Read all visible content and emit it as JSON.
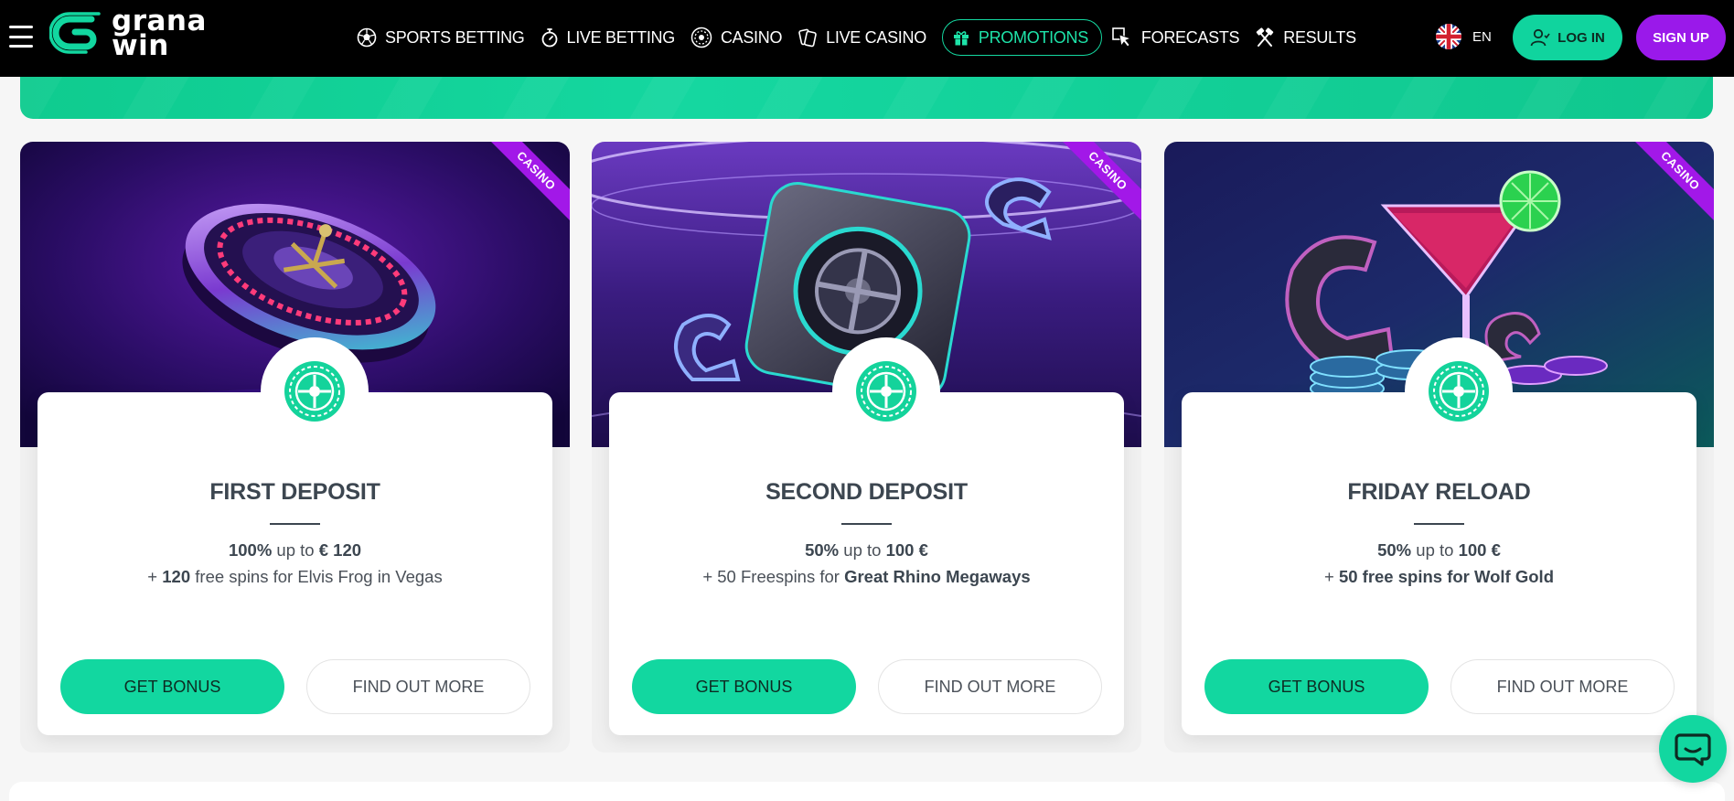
{
  "brand": {
    "logo_line1": "grana",
    "logo_line2": "win"
  },
  "nav": {
    "items": [
      {
        "label": "SPORTS BETTING",
        "icon": "soccer-ball-icon"
      },
      {
        "label": "LIVE BETTING",
        "icon": "stopwatch-icon"
      },
      {
        "label": "CASINO",
        "icon": "roulette-icon"
      },
      {
        "label": "LIVE CASINO",
        "icon": "cards-icon"
      },
      {
        "label": "PROMOTIONS",
        "icon": "gift-icon",
        "active": true
      },
      {
        "label": "FORECASTS",
        "icon": "cursor-click-icon"
      },
      {
        "label": "RESULTS",
        "icon": "crossed-hammers-icon"
      }
    ]
  },
  "header": {
    "language": "EN",
    "login_label": "LOG IN",
    "signup_label": "SIGN UP"
  },
  "colors": {
    "accent": "#12d7a0",
    "brand_purple": "#9a19ea",
    "header_bg": "#000000"
  },
  "promos": [
    {
      "badge": "CASINO",
      "title": "FIRST DEPOSIT",
      "line1_bold1": "100%",
      "line1_text": " up to ",
      "line1_bold2": "€ 120",
      "line2_text1": "+ ",
      "line2_bold": "120",
      "line2_text2": " free spins for Elvis Frog in Vegas",
      "get_bonus_label": "GET BONUS",
      "find_out_label": "FIND OUT MORE"
    },
    {
      "badge": "CASINO",
      "title": "SECOND DEPOSIT",
      "line1_bold1": "50%",
      "line1_text": " up to ",
      "line1_bold2": "100 €",
      "line2_text1": "+ 50 Freespins for ",
      "line2_bold": "Great Rhino Megaways",
      "line2_text2": "",
      "get_bonus_label": "GET BONUS",
      "find_out_label": "FIND OUT MORE"
    },
    {
      "badge": "CASINO",
      "title": "FRIDAY RELOAD",
      "line1_bold1": "50%",
      "line1_text": " up to ",
      "line1_bold2": "100 €",
      "line2_text1": "+ ",
      "line2_bold": "50 free spins for Wolf Gold",
      "line2_text2": "",
      "get_bonus_label": "GET BONUS",
      "find_out_label": "FIND OUT MORE"
    }
  ]
}
